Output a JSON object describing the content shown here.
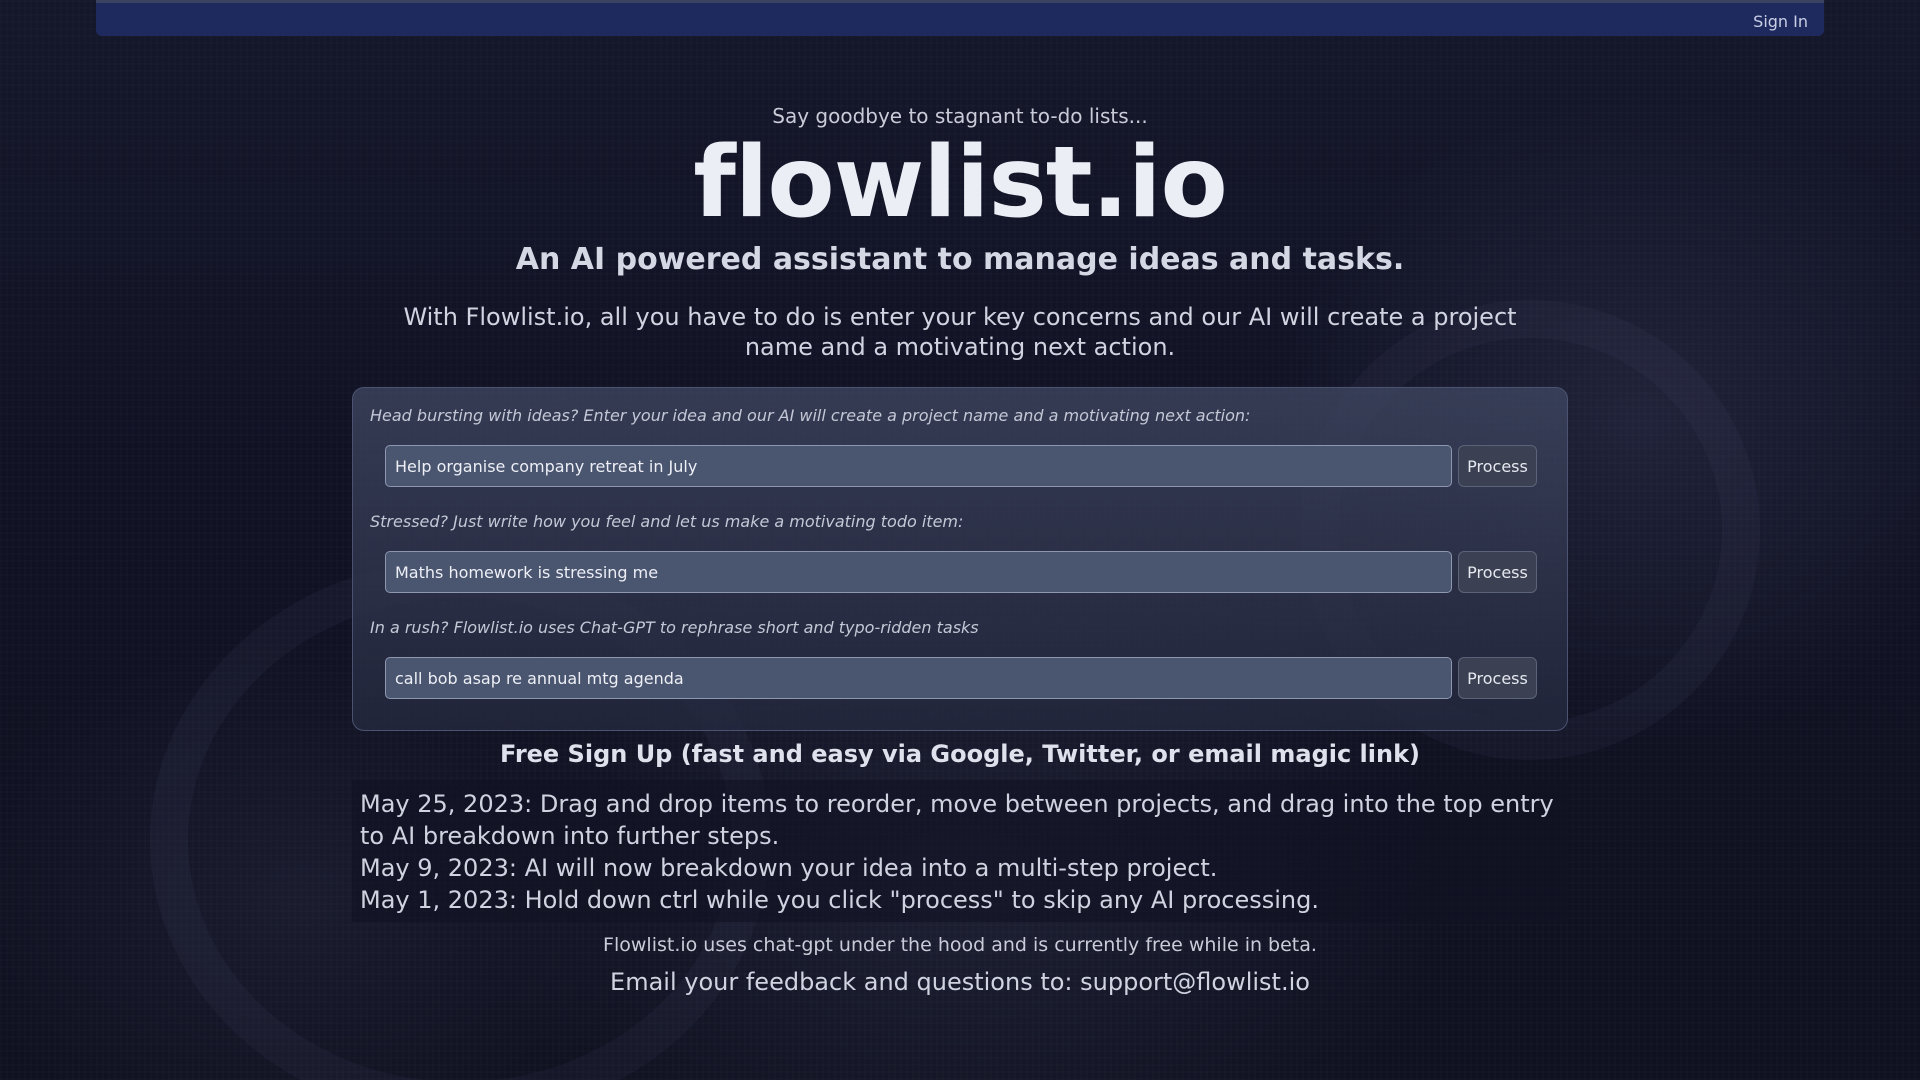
{
  "nav": {
    "signin_label": "Sign In"
  },
  "hero": {
    "tagline": "Say goodbye to stagnant to-do lists...",
    "brand": "flowlist.io",
    "subtitle": "An AI powered assistant to manage ideas and tasks.",
    "intro": "With Flowlist.io, all you have to do is enter your key concerns and our AI will create a project name and a motivating next action."
  },
  "panel": {
    "sections": [
      {
        "prompt": "Head bursting with ideas? Enter your idea and our AI will create a project name and a motivating next action:",
        "input_value": "Help organise company retreat in July",
        "button_label": "Process"
      },
      {
        "prompt": "Stressed? Just write how you feel and let us make a motivating todo item:",
        "input_value": "Maths homework is stressing me",
        "button_label": "Process"
      },
      {
        "prompt": "In a rush? Flowlist.io uses Chat-GPT to rephrase short and typo-ridden tasks",
        "input_value": "call bob asap re annual mtg agenda",
        "button_label": "Process"
      }
    ]
  },
  "signup": {
    "label": "Free Sign Up (fast and easy via Google, Twitter, or email magic link)"
  },
  "news": {
    "items": [
      "May 25, 2023: Drag and drop items to reorder, move between projects, and drag into the top entry to AI breakdown into further steps.",
      "May 9, 2023: AI will now breakdown your idea into a multi-step project.",
      "May 1, 2023: Hold down ctrl while you click \"process\" to skip any AI processing."
    ]
  },
  "footer": {
    "note": "Flowlist.io uses chat-gpt under the hood and is currently free while in beta.",
    "contact": "Email your feedback and questions to: support@flowlist.io"
  },
  "colors": {
    "navbar": "#1e2a5e",
    "background": "#101224",
    "input_bg": "#4a5570",
    "button_bg": "#3b4152"
  }
}
